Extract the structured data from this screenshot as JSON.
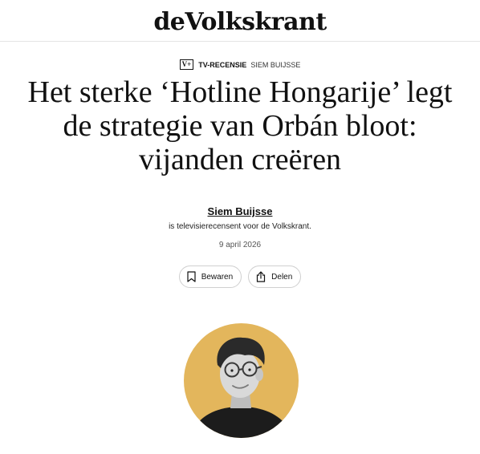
{
  "masthead": {
    "logo_text": "deVolkskrant"
  },
  "kicker": {
    "badge": "V+",
    "section": "TV-RECENSIE",
    "author": "SIEM BUIJSSE"
  },
  "headline": "Het sterke ‘Hotline Hongarije’ legt de strategie van Orbán bloot: vijanden creëren",
  "byline": {
    "name": "Siem Buijsse",
    "description": "is televisierecensent voor de Volkskrant.",
    "date": "9 april 2026"
  },
  "actions": {
    "save_label": "Bewaren",
    "share_label": "Delen"
  },
  "icons": {
    "save": "bookmark-icon",
    "share": "share-icon"
  },
  "avatar": {
    "background_color": "#e3b65c"
  }
}
